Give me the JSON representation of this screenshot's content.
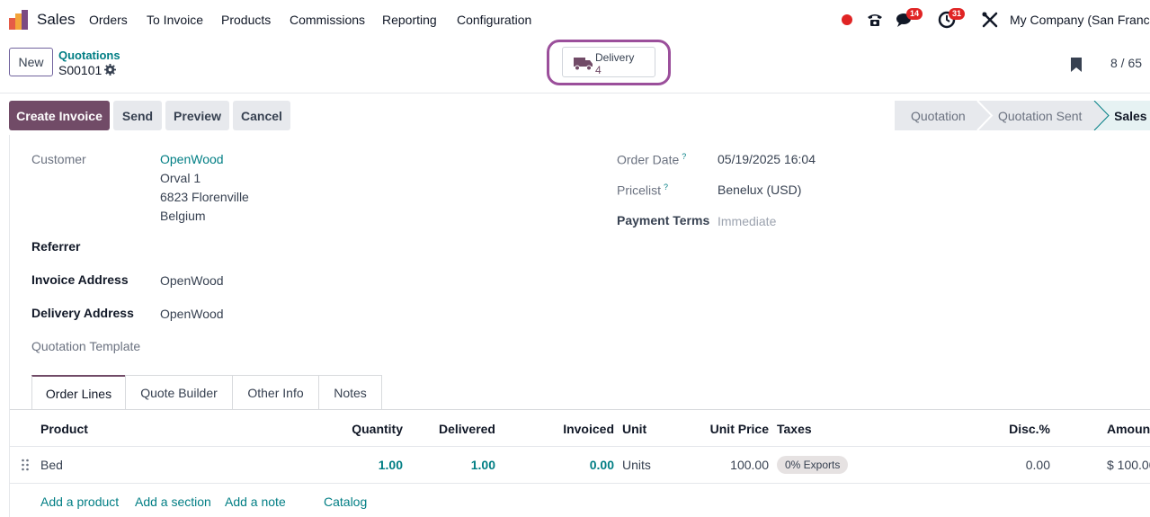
{
  "app": {
    "name": "Sales",
    "nav": [
      "Orders",
      "To Invoice",
      "Products",
      "Commissions",
      "Reporting",
      "Configuration"
    ],
    "messages_badge": "14",
    "activities_badge": "31",
    "company": "My Company (San Francisco)"
  },
  "control": {
    "new_label": "New",
    "breadcrumb_parent": "Quotations",
    "record_name": "S00101",
    "smart_button": {
      "label": "Delivery",
      "value": "4"
    },
    "pager": "8 / 65"
  },
  "actions": {
    "create_invoice": "Create Invoice",
    "send": "Send",
    "preview": "Preview",
    "cancel": "Cancel"
  },
  "statusbar": [
    "Quotation",
    "Quotation Sent",
    "Sales Order"
  ],
  "form": {
    "customer_label": "Customer",
    "customer_name": "OpenWood",
    "address_line1": "Orval 1",
    "address_line2": "6823 Florenville",
    "address_line3": "Belgium",
    "referrer_label": "Referrer",
    "invoice_address_label": "Invoice Address",
    "invoice_address": "OpenWood",
    "delivery_address_label": "Delivery Address",
    "delivery_address": "OpenWood",
    "quotation_template_label": "Quotation Template",
    "order_date_label": "Order Date",
    "order_date": "05/19/2025 16:04",
    "pricelist_label": "Pricelist",
    "pricelist": "Benelux (USD)",
    "payment_terms_label": "Payment Terms",
    "payment_terms": "Immediate",
    "help_mark": "?"
  },
  "tabs": [
    "Order Lines",
    "Quote Builder",
    "Other Info",
    "Notes"
  ],
  "table": {
    "headers": {
      "product": "Product",
      "quantity": "Quantity",
      "delivered": "Delivered",
      "invoiced": "Invoiced",
      "unit": "Unit",
      "unit_price": "Unit Price",
      "taxes": "Taxes",
      "discount": "Disc.%",
      "amount": "Amount"
    },
    "rows": [
      {
        "product": "Bed",
        "quantity": "1.00",
        "delivered": "1.00",
        "invoiced": "0.00",
        "unit": "Units",
        "unit_price": "100.00",
        "tax": "0% Exports",
        "discount": "0.00",
        "amount": "$ 100.00"
      }
    ],
    "add_product": "Add a product",
    "add_section": "Add a section",
    "add_note": "Add a note",
    "catalog": "Catalog"
  },
  "colors": {
    "brand": "#714b67",
    "link": "#017e84",
    "highlight": "#9b4f9b",
    "badge": "#e02424"
  }
}
